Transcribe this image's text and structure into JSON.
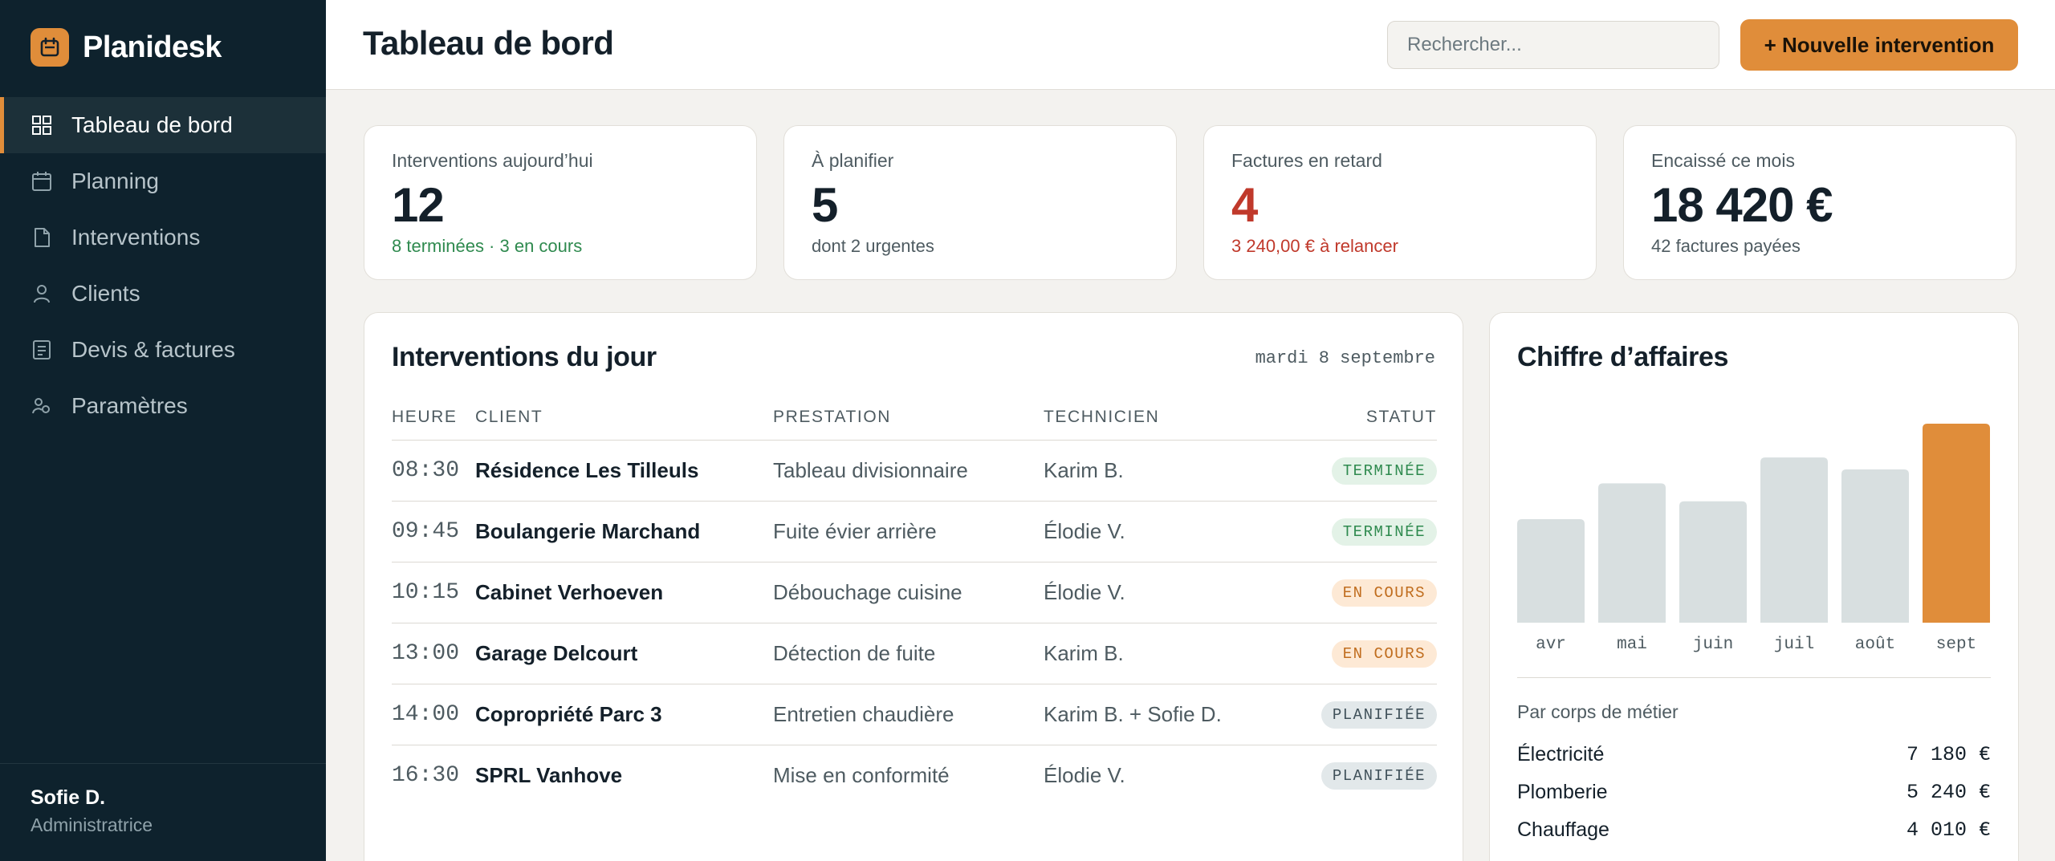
{
  "app": {
    "name": "Planidesk"
  },
  "sidebar": {
    "items": [
      {
        "label": "Tableau de bord",
        "icon": "dashboard-icon",
        "active": true
      },
      {
        "label": "Planning",
        "icon": "calendar-icon"
      },
      {
        "label": "Interventions",
        "icon": "document-icon"
      },
      {
        "label": "Clients",
        "icon": "user-icon"
      },
      {
        "label": "Devis & factures",
        "icon": "invoice-icon"
      },
      {
        "label": "Paramètres",
        "icon": "settings-icon"
      }
    ],
    "user": {
      "name": "Sofie D.",
      "role": "Administratrice"
    }
  },
  "header": {
    "title": "Tableau de bord",
    "search_placeholder": "Rechercher...",
    "new_button": "+ Nouvelle intervention"
  },
  "stats": [
    {
      "label": "Interventions aujourd’hui",
      "value": "12",
      "sub": "8 terminées · 3 en cours",
      "sub_color": "#2f8a4f",
      "value_color": "#14202a"
    },
    {
      "label": "À planifier",
      "value": "5",
      "sub": "dont 2 urgentes",
      "sub_color": "#4e5b61",
      "value_color": "#14202a"
    },
    {
      "label": "Factures en retard",
      "value": "4",
      "sub": "3 240,00 € à relancer",
      "sub_color": "#c0392b",
      "value_color": "#c0392b"
    },
    {
      "label": "Encaissé ce mois",
      "value": "18 420 €",
      "sub": "42 factures payées",
      "sub_color": "#4e5b61",
      "value_color": "#14202a"
    }
  ],
  "interventions": {
    "title": "Interventions du jour",
    "date": "mardi 8 septembre",
    "columns": {
      "time": "HEURE",
      "client": "CLIENT",
      "service": "PRESTATION",
      "tech": "TECHNICIEN",
      "status": "STATUT"
    },
    "rows": [
      {
        "time": "08:30",
        "client": "Résidence Les Tilleuls",
        "service": "Tableau divisionnaire",
        "tech": "Karim B.",
        "status": "TERMINÉE",
        "kind": "done"
      },
      {
        "time": "09:45",
        "client": "Boulangerie Marchand",
        "service": "Fuite évier arrière",
        "tech": "Élodie V.",
        "status": "TERMINÉE",
        "kind": "done"
      },
      {
        "time": "10:15",
        "client": "Cabinet Verhoeven",
        "service": "Débouchage cuisine",
        "tech": "Élodie V.",
        "status": "EN COURS",
        "kind": "progress"
      },
      {
        "time": "13:00",
        "client": "Garage Delcourt",
        "service": "Détection de fuite",
        "tech": "Karim B.",
        "status": "EN COURS",
        "kind": "progress"
      },
      {
        "time": "14:00",
        "client": "Copropriété Parc 3",
        "service": "Entretien chaudière",
        "tech": "Karim B. + Sofie D.",
        "status": "PLANIFIÉE",
        "kind": "planned"
      },
      {
        "time": "16:30",
        "client": "SPRL Vanhove",
        "service": "Mise en conformité",
        "tech": "Élodie V.",
        "status": "PLANIFIÉE",
        "kind": "planned"
      }
    ]
  },
  "revenue": {
    "title": "Chiffre d’affaires",
    "breakdown_title": "Par corps de métier",
    "breakdown": [
      {
        "name": "Électricité",
        "amount": "7 180 €"
      },
      {
        "name": "Plomberie",
        "amount": "5 240 €"
      },
      {
        "name": "Chauffage",
        "amount": "4 010 €"
      }
    ]
  },
  "colors": {
    "accent": "#e08d3a",
    "sidebar": "#0e222d",
    "bar": "#d8dfe0",
    "danger": "#c0392b",
    "success": "#2f8a4f"
  },
  "chart_data": {
    "type": "bar",
    "categories": [
      "avr",
      "mai",
      "juin",
      "juil",
      "août",
      "sept"
    ],
    "values": [
      0.52,
      0.7,
      0.61,
      0.83,
      0.77,
      1.0
    ],
    "highlight_index": 5,
    "title": "Chiffre d’affaires",
    "xlabel": "",
    "ylabel": "",
    "grid": false
  }
}
